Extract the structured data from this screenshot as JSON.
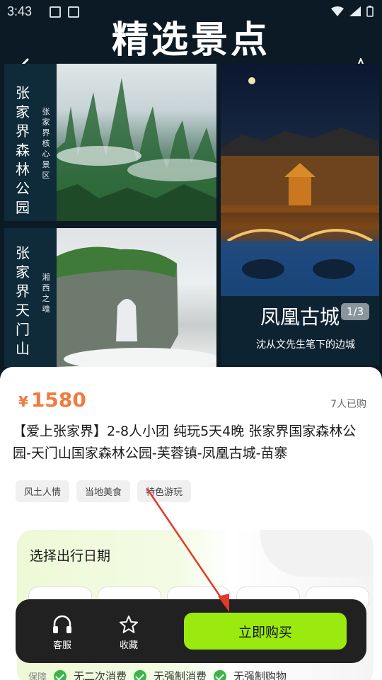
{
  "status_bar": {
    "time": "3:43"
  },
  "page_title": "精选景点",
  "cards": [
    {
      "title": "张家界森林公园",
      "title_chars": [
        "张",
        "家",
        "界",
        "森",
        "林",
        "公",
        "园"
      ],
      "subtitle_chars": [
        "张",
        "家",
        "界",
        "核",
        "心",
        "景",
        "区"
      ]
    },
    {
      "title": "张家界天门山",
      "title_chars": [
        "张",
        "家",
        "界",
        "天",
        "门",
        "山"
      ],
      "subtitle_chars": [
        "湘",
        "西",
        "之",
        "魂"
      ]
    },
    {
      "title": "凤凰古城",
      "pager": "1/3",
      "subtitle": "沈从文先生笔下的边城"
    }
  ],
  "product": {
    "currency": "¥",
    "price": "1580",
    "sold_count": "7人已购",
    "title": "【爱上张家界】2-8人小团 纯玩5天4晚 张家界国家森林公园-天门山国家森林公园-芙蓉镇-凤凰古城-苗寨",
    "tags": [
      "风土人情",
      "当地美食",
      "特色游玩"
    ]
  },
  "date_section": {
    "title": "选择出行日期"
  },
  "guarantees": {
    "label": "保障",
    "items": [
      "无二次消费",
      "无强制消费",
      "无强制购物"
    ]
  },
  "action_bar": {
    "service_label": "客服",
    "collect_label": "收藏",
    "buy_label": "立即购买"
  },
  "colors": {
    "price": "#f27a3f",
    "buy_button": "#9bea0f",
    "action_bar_bg": "#212121",
    "annotation_arrow": "#e0392d"
  }
}
